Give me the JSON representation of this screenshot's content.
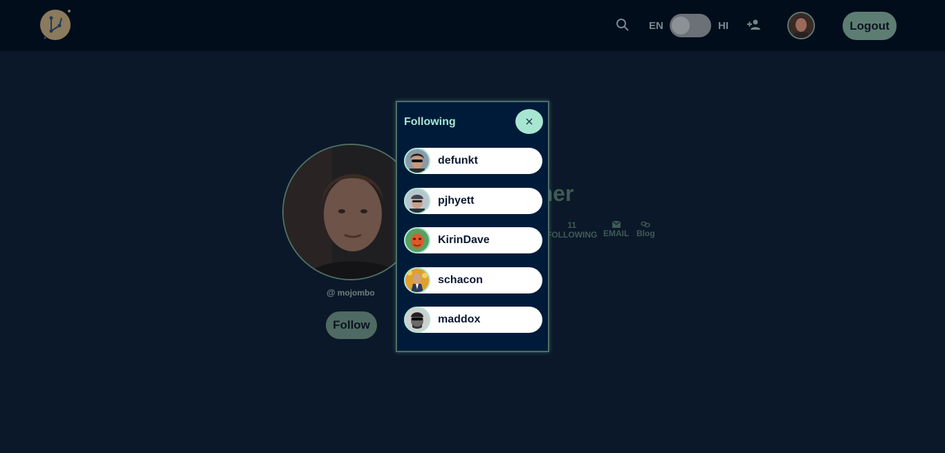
{
  "navbar": {
    "lang_left": "EN",
    "lang_right": "HI",
    "logout_label": "Logout"
  },
  "profile": {
    "name": "on-Werner",
    "handle": "mojombo",
    "follow_label": "Follow",
    "stats": {
      "following_count": "11",
      "following_label": "FOLLOWING",
      "email_label": "EMAIL",
      "blog_label": "Blog"
    }
  },
  "modal": {
    "title": "Following",
    "users": [
      {
        "name": "defunkt"
      },
      {
        "name": "pjhyett"
      },
      {
        "name": "KirinDave"
      },
      {
        "name": "schacon"
      },
      {
        "name": "maddox"
      }
    ]
  },
  "icons": {
    "search": "search-icon",
    "add_user": "add-user-icon",
    "close": "close-icon",
    "email": "email-icon",
    "link": "link-icon"
  },
  "colors": {
    "navbar_bg": "#020d1c",
    "page_bg": "#0b1829",
    "accent": "#a7e6d1",
    "button": "#5e7d72",
    "modal_bg": "#001b3a"
  }
}
